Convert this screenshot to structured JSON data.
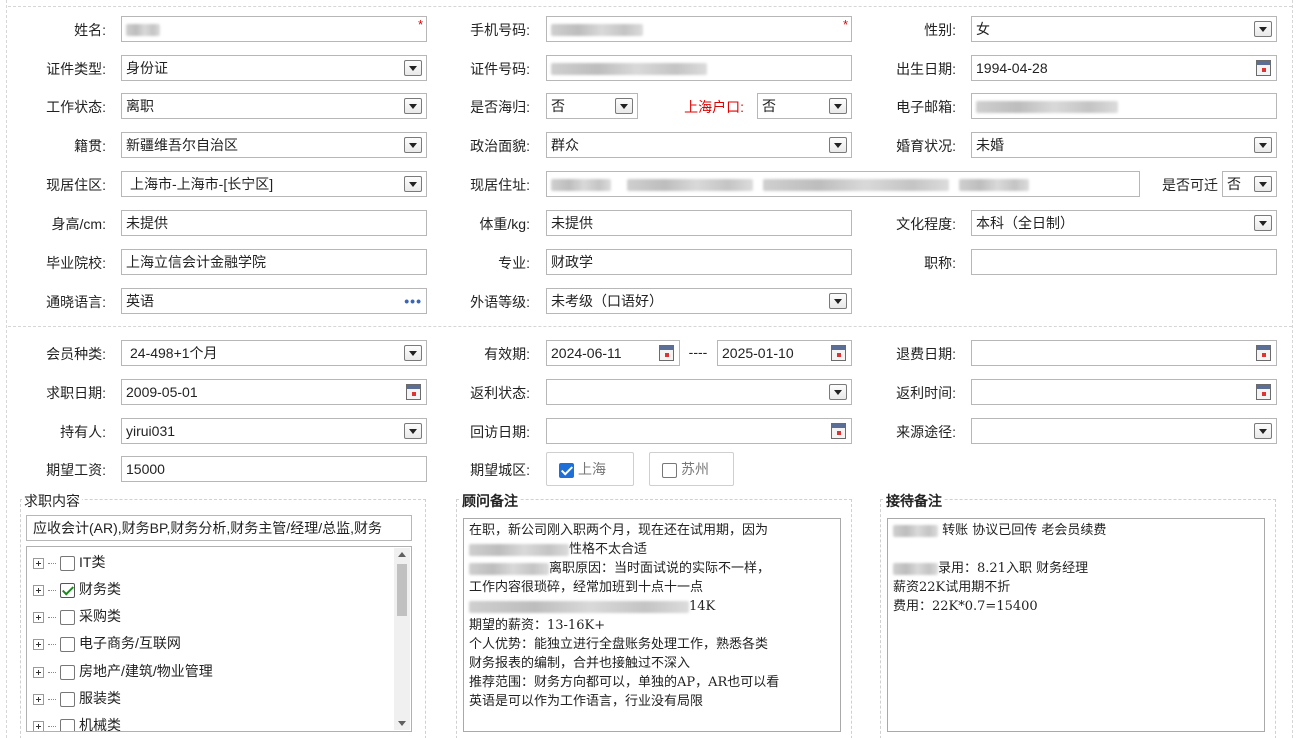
{
  "personal": {
    "name_label": "姓名:",
    "phone_label": "手机号码:",
    "gender_label": "性别:",
    "gender_value": "女",
    "required_mark": "*",
    "id_type_label": "证件类型:",
    "id_type_value": "身份证",
    "id_number_label": "证件号码:",
    "birth_label": "出生日期:",
    "birth_value": "1994-04-28",
    "work_status_label": "工作状态:",
    "work_status_value": "离职",
    "overseas_label": "是否海归:",
    "overseas_value": "否",
    "hukou_label": "上海户口:",
    "hukou_value": "否",
    "email_label": "电子邮箱:",
    "native_label": "籍贯:",
    "native_value": "新疆维吾尔自治区",
    "political_label": "政治面貌:",
    "political_value": "群众",
    "marital_label": "婚育状况:",
    "marital_value": "未婚",
    "residence_area_label": "现居住区:",
    "residence_area_value": "上海市-上海市-[长宁区]",
    "residence_addr_label": "现居住址:",
    "relocatable_label": "是否可迁",
    "relocatable_value": "否",
    "height_label": "身高/cm:",
    "height_value": "未提供",
    "weight_label": "体重/kg:",
    "weight_value": "未提供",
    "education_label": "文化程度:",
    "education_value": "本科（全日制）",
    "school_label": "毕业院校:",
    "school_value": "上海立信会计金融学院",
    "major_label": "专业:",
    "major_value": "财政学",
    "title_label": "职称:",
    "language_label": "通晓语言:",
    "language_value": "英语",
    "language_more": "•••",
    "foreign_level_label": "外语等级:",
    "foreign_level_value": "未考级（口语好）"
  },
  "member": {
    "type_label": "会员种类:",
    "type_value": "24-498+1个月",
    "valid_label": "有效期:",
    "valid_from": "2024-06-11",
    "valid_sep": "----",
    "valid_to": "2025-01-10",
    "refund_date_label": "退费日期:",
    "job_date_label": "求职日期:",
    "job_date_value": "2009-05-01",
    "rebate_status_label": "返利状态:",
    "rebate_time_label": "返利时间:",
    "holder_label": "持有人:",
    "holder_value": "yirui031",
    "revisit_label": "回访日期:",
    "source_label": "来源途径:",
    "salary_label": "期望工资:",
    "salary_value": "15000",
    "city_label": "期望城区:",
    "city_options": [
      {
        "label": "上海",
        "checked": true
      },
      {
        "label": "苏州",
        "checked": false
      }
    ]
  },
  "job_content": {
    "title": "求职内容",
    "summary": "应收会计(AR),财务BP,财务分析,财务主管/经理/总监,财务",
    "tree": [
      {
        "label": "IT类",
        "checked": false
      },
      {
        "label": "财务类",
        "checked": true
      },
      {
        "label": "采购类",
        "checked": false
      },
      {
        "label": "电子商务/互联网",
        "checked": false
      },
      {
        "label": "房地产/建筑/物业管理",
        "checked": false
      },
      {
        "label": "服装类",
        "checked": false
      },
      {
        "label": "机械类",
        "checked": false
      }
    ]
  },
  "advisor_notes": {
    "title": "顾问备注",
    "lines": [
      {
        "pre": 0,
        "text": "在职，新公司刚入职两个月，现在还在试用期，因为"
      },
      {
        "pre": 100,
        "text": "性格不太合适"
      },
      {
        "pre": 80,
        "text": "离职原因：当时面试说的实际不一样，"
      },
      {
        "pre": 0,
        "text": "工作内容很琐碎，经常加班到十点十一点"
      },
      {
        "pre": 220,
        "text": "14K"
      },
      {
        "pre": 0,
        "text": "期望的薪资：13-16K+"
      },
      {
        "pre": 0,
        "text": "个人优势：能独立进行全盘账务处理工作，熟悉各类"
      },
      {
        "pre": 0,
        "text": "财务报表的编制，合并也接触过不深入"
      },
      {
        "pre": 0,
        "text": "推荐范围：财务方向都可以，单独的AP，AR也可以看"
      },
      {
        "pre": 0,
        "text": "英语是可以作为工作语言，行业没有局限"
      }
    ]
  },
  "reception_notes": {
    "title": "接待备注",
    "lines": [
      {
        "pre": 45,
        "text": "  转账 协议已回传 老会员续费"
      },
      {
        "pre": 0,
        "text": ""
      },
      {
        "pre": 45,
        "text": "录用：8.21入职 财务经理"
      },
      {
        "pre": 0,
        "text": "薪资22K试用期不折"
      },
      {
        "pre": 0,
        "text": "费用：22K*0.7=15400"
      }
    ]
  },
  "colors": {
    "required": "#e00000",
    "checkbox_blue": "#1f6fd8",
    "checkmark_green": "#1a8a1a"
  }
}
